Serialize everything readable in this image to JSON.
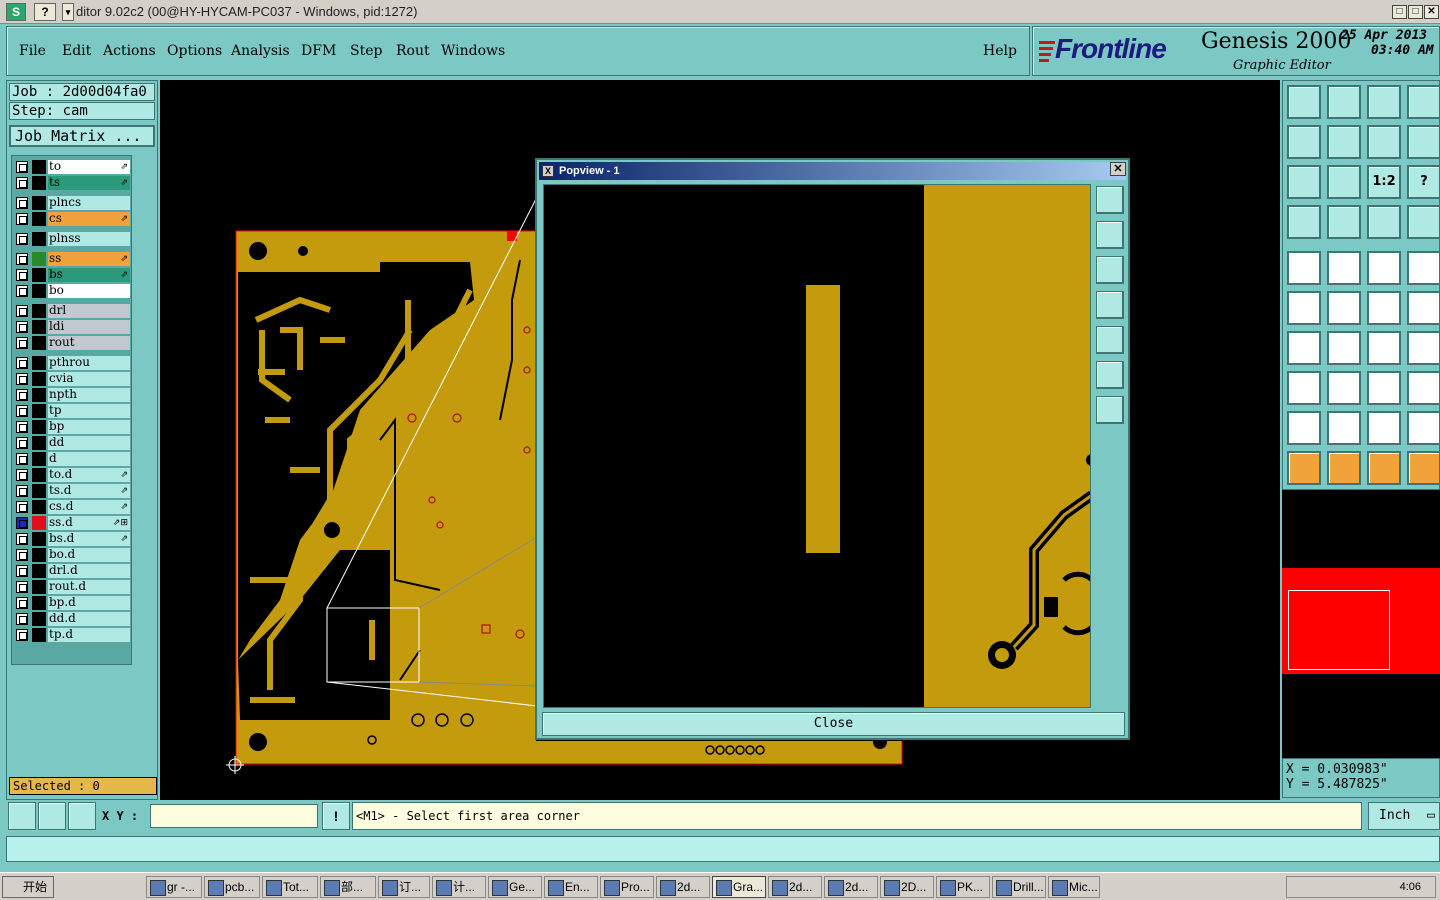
{
  "window": {
    "title": "ditor 9.02c2 (00@HY-HYCAM-PC037 - Windows, pid:1272)",
    "app_icon": "S",
    "help_icon": "?",
    "controls": [
      "□",
      "□",
      "✕"
    ]
  },
  "menu": {
    "items": [
      "File",
      "Edit",
      "Actions",
      "Options",
      "Analysis",
      "DFM",
      "Step",
      "Rout",
      "Windows"
    ],
    "help": "Help"
  },
  "brand": {
    "logo": "Frontline",
    "product": "Genesis 2000",
    "subtitle": "Graphic Editor",
    "date": "25 Apr 2013",
    "time": "03:40 AM"
  },
  "job": {
    "job_label": "Job : 2d00d04fa0",
    "step_label": "Step: cam",
    "matrix_button": "Job Matrix ..."
  },
  "layers": [
    {
      "name": "to",
      "color": "#ffffff",
      "swatch": "#000000",
      "mark": "⇗"
    },
    {
      "name": "ts",
      "color": "#2a9a7a",
      "swatch": "#000000",
      "mark": "⇗"
    },
    {
      "name": "plncs",
      "color": "#b0e8e4",
      "swatch": "#000000",
      "mark": ""
    },
    {
      "name": "cs",
      "color": "#f2a23a",
      "swatch": "#000000",
      "mark": "⇗"
    },
    {
      "name": "plnss",
      "color": "#b0e8e4",
      "swatch": "#000000",
      "mark": ""
    },
    {
      "name": "ss",
      "color": "#f2a23a",
      "swatch": "#2a8a2a",
      "mark": "⇗"
    },
    {
      "name": "bs",
      "color": "#2a9a7a",
      "swatch": "#000000",
      "mark": "⇗"
    },
    {
      "name": "bo",
      "color": "#ffffff",
      "swatch": "#000000",
      "mark": ""
    },
    {
      "name": "drl",
      "color": "#c0c8d0",
      "swatch": "#000000",
      "mark": ""
    },
    {
      "name": "ldi",
      "color": "#c0c8d0",
      "swatch": "#000000",
      "mark": ""
    },
    {
      "name": "rout",
      "color": "#c0c8d0",
      "swatch": "#000000",
      "mark": ""
    },
    {
      "name": "pthrou",
      "color": "#b0e8e4",
      "swatch": "#000000",
      "mark": ""
    },
    {
      "name": "cvia",
      "color": "#b0e8e4",
      "swatch": "#000000",
      "mark": ""
    },
    {
      "name": "npth",
      "color": "#b0e8e4",
      "swatch": "#000000",
      "mark": ""
    },
    {
      "name": "tp",
      "color": "#b0e8e4",
      "swatch": "#000000",
      "mark": ""
    },
    {
      "name": "bp",
      "color": "#b0e8e4",
      "swatch": "#000000",
      "mark": ""
    },
    {
      "name": "dd",
      "color": "#b0e8e4",
      "swatch": "#000000",
      "mark": ""
    },
    {
      "name": "d",
      "color": "#b0e8e4",
      "swatch": "#000000",
      "mark": ""
    },
    {
      "name": "to.d",
      "color": "#b0e8e4",
      "swatch": "#000000",
      "mark": "⇗"
    },
    {
      "name": "ts.d",
      "color": "#b0e8e4",
      "swatch": "#000000",
      "mark": "⇗"
    },
    {
      "name": "cs.d",
      "color": "#b0e8e4",
      "swatch": "#000000",
      "mark": "⇗"
    },
    {
      "name": "ss.d",
      "color": "#b0e8e4",
      "swatch": "#e0101a",
      "mark": "⇗⊞",
      "active": true
    },
    {
      "name": "bs.d",
      "color": "#b0e8e4",
      "swatch": "#000000",
      "mark": "⇗"
    },
    {
      "name": "bo.d",
      "color": "#b0e8e4",
      "swatch": "#000000",
      "mark": ""
    },
    {
      "name": "drl.d",
      "color": "#b0e8e4",
      "swatch": "#000000",
      "mark": ""
    },
    {
      "name": "rout.d",
      "color": "#b0e8e4",
      "swatch": "#000000",
      "mark": ""
    },
    {
      "name": "bp.d",
      "color": "#b0e8e4",
      "swatch": "#000000",
      "mark": ""
    },
    {
      "name": "dd.d",
      "color": "#b0e8e4",
      "swatch": "#000000",
      "mark": ""
    },
    {
      "name": "tp.d",
      "color": "#b0e8e4",
      "swatch": "#000000",
      "mark": ""
    }
  ],
  "selected_label": "Selected : 0",
  "popview": {
    "title": "Popview - 1",
    "close_button": "Close"
  },
  "tools": {
    "labels": [
      "",
      "",
      "",
      "",
      "",
      "",
      "",
      "",
      "",
      "",
      "1:2",
      "?",
      "",
      "",
      "",
      "",
      "",
      "",
      "",
      "",
      "",
      "",
      "",
      "",
      "",
      "",
      "",
      "",
      "",
      "",
      "",
      "",
      "",
      "",
      "",
      "",
      "",
      "",
      "",
      ""
    ],
    "icons": [
      "open-icon",
      "save-icon",
      "home-icon",
      "window-icon",
      "move-left-icon",
      "move-right-icon",
      "swap-icon",
      "s-curve-icon",
      "fit-icon",
      "center-icon",
      "scale-icon",
      "help-icon",
      "tools-icon",
      "grid-icon",
      "panel-red-icon",
      "panel-red-2-icon",
      "pad-icon",
      "line-red-icon",
      "measure-icon",
      "circle-icon",
      "net-icon",
      "cross-icon",
      "move-point-icon",
      "move-point-2-icon",
      "angle-icon",
      "slash-icon",
      "rotate-icon",
      "align-icon",
      "select-red-icon",
      "minus-icon",
      "resize-icon",
      "group-icon",
      "arc-icon",
      "triangle-icon",
      "triangle-up-icon",
      "triangle-blue-icon",
      "pointer-icon",
      "pointer-box-icon",
      "pointer-cross-icon",
      "pointer-net-icon"
    ]
  },
  "coords": {
    "x": "X = 0.030983\"",
    "y": "Y = 5.487825\""
  },
  "status": {
    "xy_label": "X Y :",
    "xy_value": "",
    "info_icon": "!",
    "prompt": "<M1> - Select first area corner",
    "unit": "Inch",
    "message": ""
  },
  "taskbar": {
    "start": "开始",
    "tasks": [
      "gr -...",
      "pcb...",
      "Tot...",
      "部...",
      "订...",
      "计...",
      "Ge...",
      "En...",
      "Pro...",
      "2d...",
      "Gra...",
      "2d...",
      "2d...",
      "2D...",
      "PK...",
      "Drill...",
      "Mic..."
    ],
    "active_task": "Gra...",
    "clock": "4:06"
  },
  "colors": {
    "panel": "#7cc8c4",
    "copper": "#c39b0c",
    "canvas": "#000000",
    "highlight": "#ff0000"
  }
}
